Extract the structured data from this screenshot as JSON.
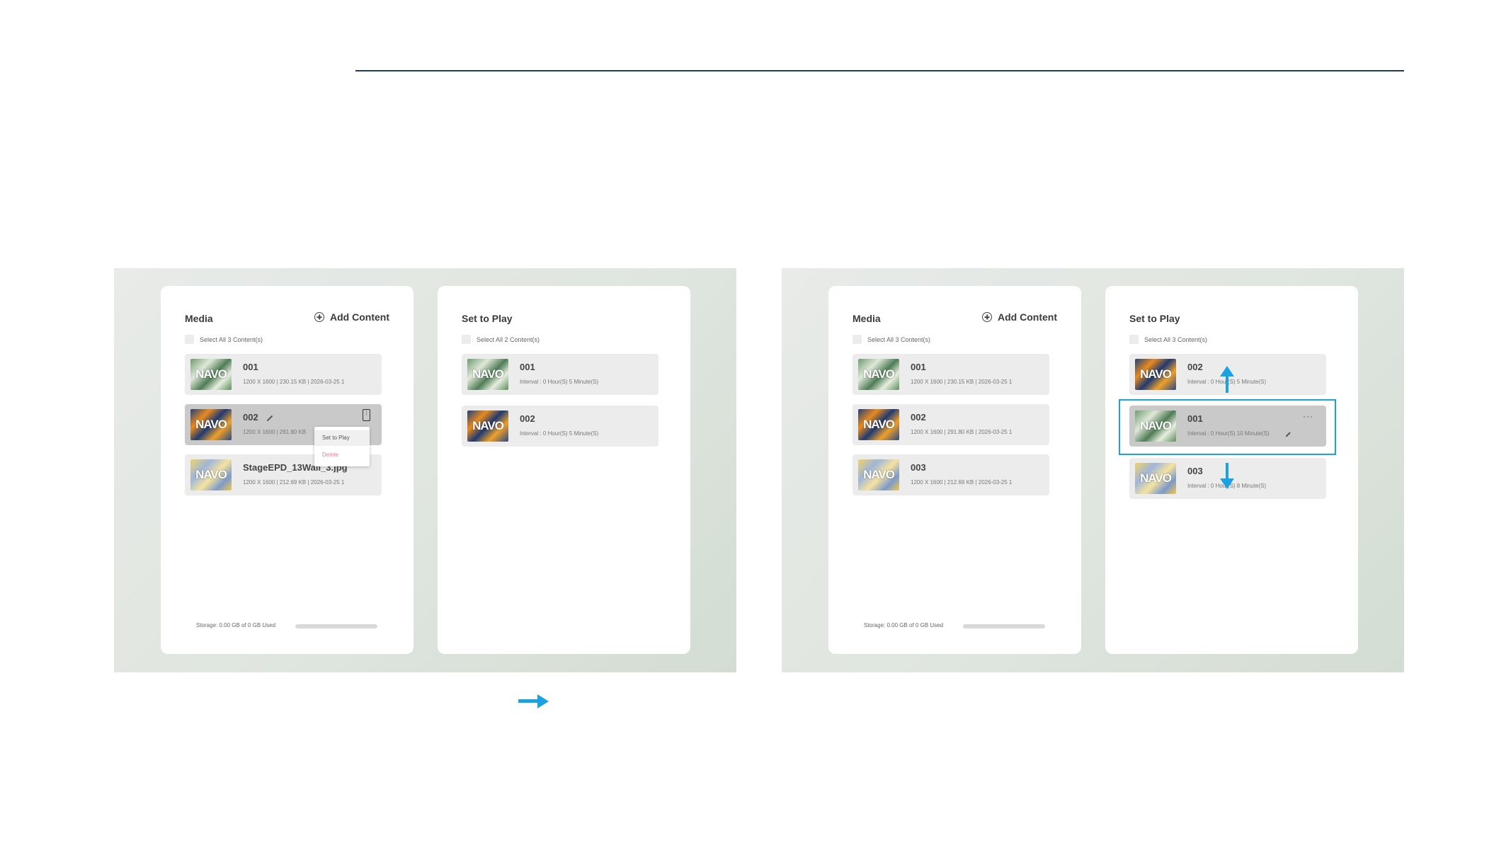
{
  "left_screen": {
    "media": {
      "title": "Media",
      "add_label": "Add Content",
      "select_all": "Select All 3 Content(s)",
      "items": [
        {
          "name": "001",
          "meta": "1200 X 1600  |  230.15 KB  |  2026-03-25 1",
          "thumb": "green",
          "logo": "NAVO"
        },
        {
          "name": "002",
          "meta": "1200 X 1600  |  291.80 KB",
          "thumb": "blue",
          "logo": "NAVO"
        },
        {
          "name": "StageEPD_13Wall_3.jpg",
          "meta": "1200 X 1600  |  212.69 KB  |  2026-03-25 1",
          "thumb": "yellow",
          "logo": "NAVO"
        }
      ],
      "context_menu": {
        "set_to_play": "Set to Play",
        "delete": "Delete"
      },
      "storage_text": "Storage: 0.00 GB of 0 GB Used"
    },
    "play": {
      "title": "Set to Play",
      "select_all": "Select All 2 Content(s)",
      "items": [
        {
          "name": "001",
          "meta": "Interval : 0 Hour(S) 5 Minute(S)",
          "thumb": "green",
          "logo": "NAVO"
        },
        {
          "name": "002",
          "meta": "Interval : 0 Hour(S) 5 Minute(S)",
          "thumb": "blue",
          "logo": "NAVO"
        }
      ]
    }
  },
  "right_screen": {
    "media": {
      "title": "Media",
      "add_label": "Add Content",
      "select_all": "Select All 3 Content(s)",
      "items": [
        {
          "name": "001",
          "meta": "1200 X 1600  |  230.15 KB  |  2026-03-25 1",
          "thumb": "green",
          "logo": "NAVO"
        },
        {
          "name": "002",
          "meta": "1200 X 1600  |  291.80 KB  |  2026-03-25 1",
          "thumb": "blue",
          "logo": "NAVO"
        },
        {
          "name": "003",
          "meta": "1200 X 1600  |  212.69 KB  |  2026-03-25 1",
          "thumb": "yellow",
          "logo": "NAVO"
        }
      ],
      "storage_text": "Storage: 0.00 GB of 0 GB Used"
    },
    "play": {
      "title": "Set to Play",
      "select_all": "Select All 3 Content(s)",
      "items": [
        {
          "name": "002",
          "meta": "Interval : 0 Hour(S) 5 Minute(S)",
          "thumb": "blue",
          "logo": "NAVO"
        },
        {
          "name": "001",
          "meta": "Interval : 0 Hour(S) 10 Minute(S)",
          "thumb": "green",
          "logo": "NAVO"
        },
        {
          "name": "003",
          "meta": "Interval : 0 Hour(S) 8 Minute(S)",
          "thumb": "yellow",
          "logo": "NAVO"
        }
      ],
      "more_label": "···"
    }
  },
  "colors": {
    "accent": "#1aa3e0",
    "rule": "#1d3c5c",
    "delete": "#e87aa0"
  }
}
